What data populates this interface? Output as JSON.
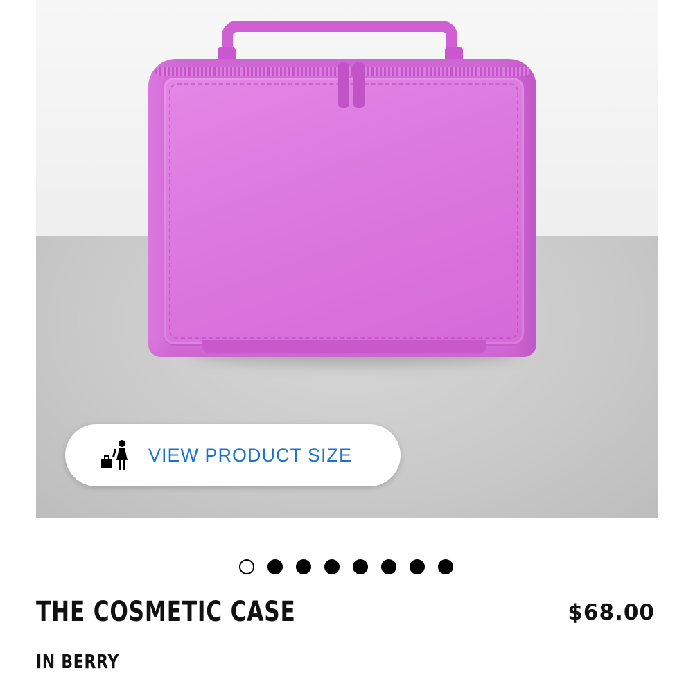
{
  "product_image": {
    "alt": "The Cosmetic Case in Berry",
    "case_color": "#d870dc"
  },
  "size_button": {
    "icon": "person-luggage-icon",
    "label": "VIEW PRODUCT SIZE",
    "label_color": "#1a73d1"
  },
  "carousel": {
    "total": 8,
    "active_index": 0
  },
  "product": {
    "title": "THE COSMETIC CASE",
    "price": "$68.00",
    "color_label": "IN BERRY"
  }
}
